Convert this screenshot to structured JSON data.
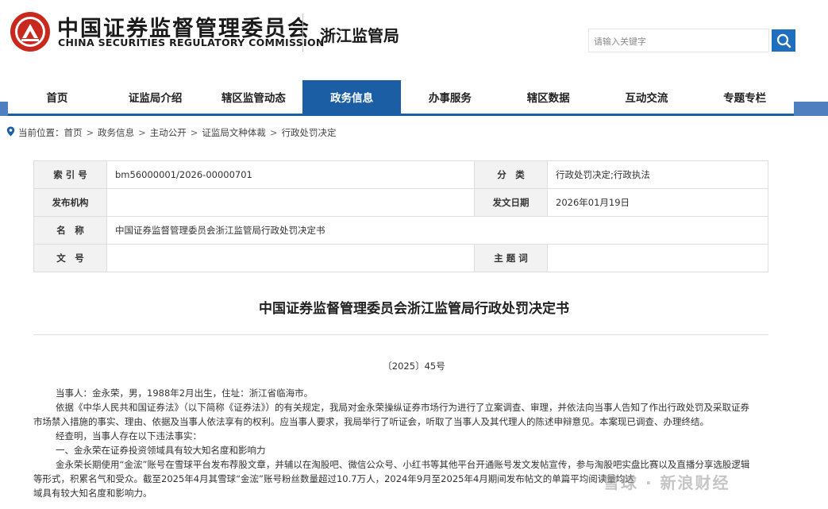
{
  "header": {
    "org_name": "中国证券监督管理委员会",
    "org_name_en": "CHINA SECURITIES REGULATORY COMMISSION",
    "bureau": "浙江监管局",
    "search_placeholder": "请输入关键字",
    "brand_color": "#1b5ea3"
  },
  "nav": {
    "items": [
      "首页",
      "证监局介绍",
      "辖区监管动态",
      "政务信息",
      "办事服务",
      "辖区数据",
      "互动交流",
      "专题专栏"
    ],
    "active": "政务信息"
  },
  "breadcrumb": {
    "label": "当前位置：",
    "items": [
      "首页",
      "政务信息",
      "主动公开",
      "证监局文种体裁",
      "行政处罚决定"
    ]
  },
  "meta": {
    "index_label": "索 引 号",
    "index_value": "bm56000001/2026-00000701",
    "category_label": "分　类",
    "category_value": "行政处罚决定;行政执法",
    "publisher_label": "发布机构",
    "publisher_value": "",
    "date_label": "发文日期",
    "date_value": "2026年01月19日",
    "name_label": "名　称",
    "name_value": "中国证券监督管理委员会浙江监管局行政处罚决定书",
    "docno_label": "文　号",
    "docno_value": "",
    "keyword_label": "主 题 词",
    "keyword_value": ""
  },
  "document": {
    "title": "中国证券监督管理委员会浙江监管局行政处罚决定书",
    "number": "〔2025〕45号",
    "paragraphs": [
      "当事人：金永荣，男，1988年2月出生，住址：浙江省临海市。",
      "依据《中华人民共和国证券法》（以下简称《证券法》）的有关规定，我局对金永荣操纵证券市场行为进行了立案调查、审理，并依法向当事人告知了作出行政处罚及采取证券",
      "市场禁入措施的事实、理由、依据及当事人依法享有的权利。应当事人要求，我局举行了听证会，听取了当事人及其代理人的陈述申辩意见。本案现已调查、办理终结。",
      "经查明，当事人存在以下违法事实：",
      "一、金永荣在证券投资领域具有较大知名度和影响力",
      "金永荣长期使用“金浤”账号在雪球平台发布荐股文章，并辅以在淘股吧、微信公众号、小红书等其他平台开通账号发文发帖宣传，参与淘股吧实盘比赛以及直播分享选股逻辑",
      "等形式，积累名气和受众。截至2025年4月其雪球“金浤”账号粉丝数量超过10.7万人，2024年9月至2025年4月期间发布帖文的单篇平均阅读量均达",
      "域具有较大知名度和影响力。"
    ]
  },
  "watermark": {
    "text": "雪球 · 新浪财经"
  }
}
